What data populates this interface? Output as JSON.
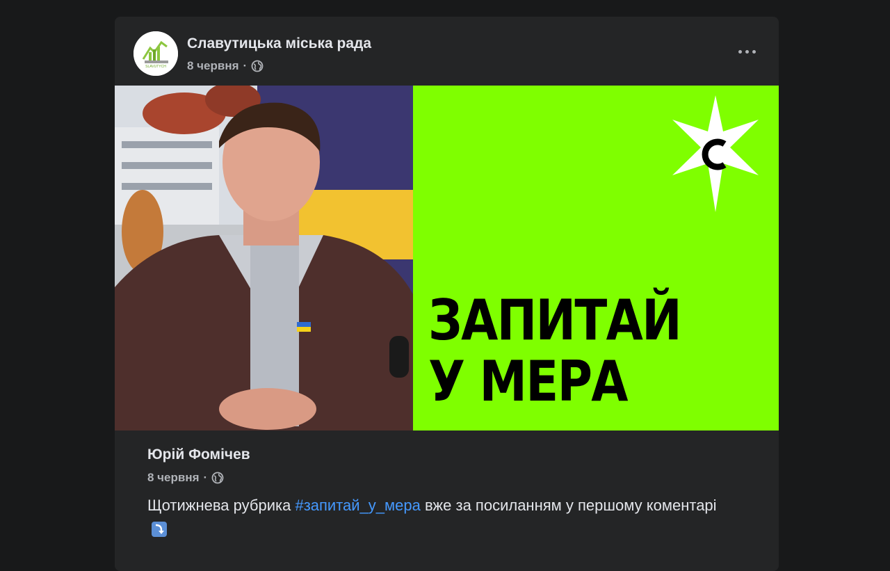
{
  "post": {
    "page_name": "Славутицька міська рада",
    "date": "8 червня",
    "separator": "·",
    "privacy_icon": "globe-icon",
    "menu_icon": "more-dots-icon"
  },
  "image": {
    "brand_title_line1": "ЗАПИТАЙ",
    "brand_title_line2": "У МЕРА",
    "logo_letter": "С",
    "colors": {
      "brand_green": "#7fff00",
      "star": "#ffffff",
      "text": "#000000"
    }
  },
  "shared": {
    "author": "Юрій Фомічев",
    "date": "8 червня",
    "separator": "·",
    "text_before": "Щотижнева рубрика ",
    "hashtag": "#запитай_у_мера",
    "text_after": " вже за посиланням у першому коментарі",
    "emoji_icon": "down-right-arrow-icon"
  },
  "colors": {
    "background": "#18191a",
    "card": "#242526",
    "primary_text": "#e4e6eb",
    "secondary_text": "#b0b3b8",
    "link": "#4599ff"
  }
}
